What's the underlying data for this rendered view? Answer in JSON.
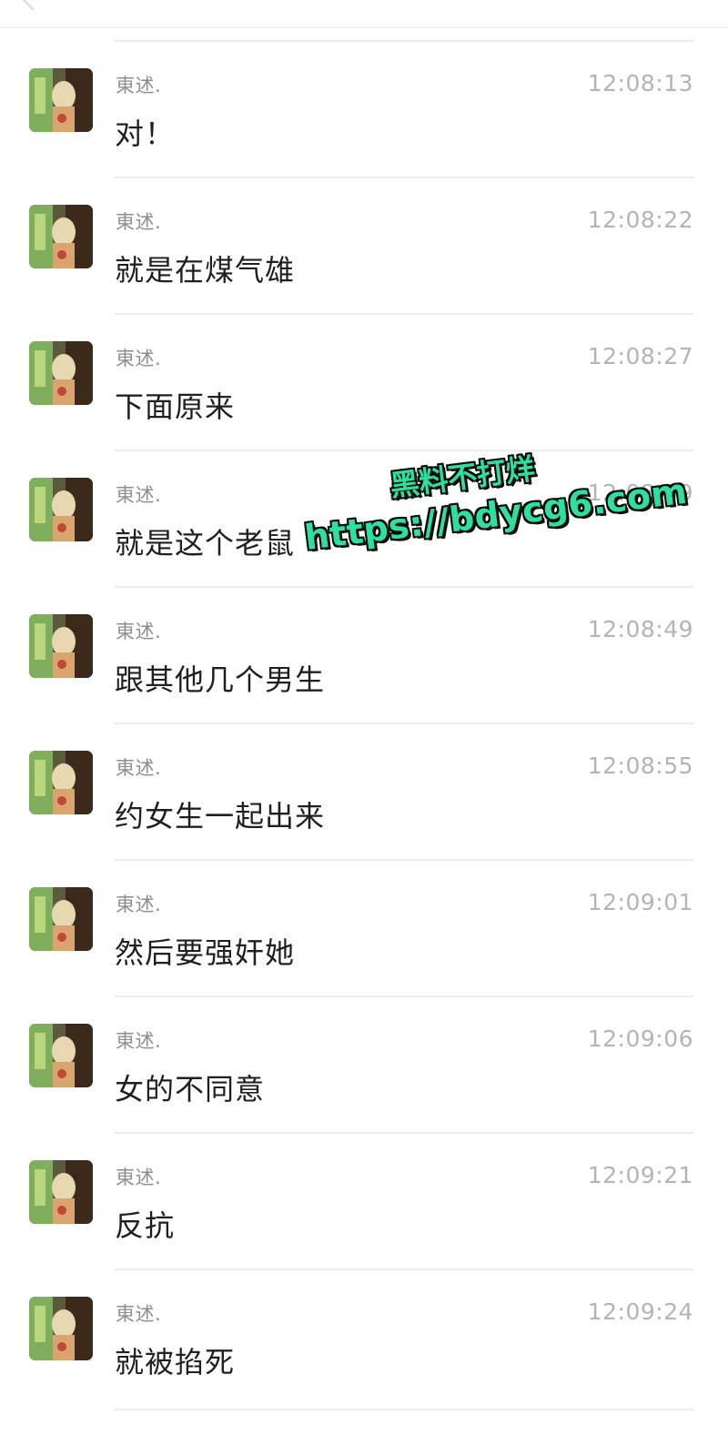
{
  "messages": [
    {
      "sender": "東述.",
      "time": "12:08:13",
      "text": "对！"
    },
    {
      "sender": "東述.",
      "time": "12:08:22",
      "text": "就是在煤气雄"
    },
    {
      "sender": "東述.",
      "time": "12:08:27",
      "text": "下面原来"
    },
    {
      "sender": "東述.",
      "time": "12:08:39",
      "text": "就是这个老鼠"
    },
    {
      "sender": "東述.",
      "time": "12:08:49",
      "text": "跟其他几个男生"
    },
    {
      "sender": "東述.",
      "time": "12:08:55",
      "text": "约女生一起出来"
    },
    {
      "sender": "東述.",
      "time": "12:09:01",
      "text": "然后要强奸她"
    },
    {
      "sender": "東述.",
      "time": "12:09:06",
      "text": "女的不同意"
    },
    {
      "sender": "東述.",
      "time": "12:09:21",
      "text": "反抗"
    },
    {
      "sender": "東述.",
      "time": "12:09:24",
      "text": "就被掐死"
    }
  ],
  "watermark": {
    "line1": "黑料不打烊",
    "line2": "https://bdycg6.com",
    "color": "#2de0a2"
  },
  "colors": {
    "sender": "#8e8e8e",
    "time": "#b4b4b4",
    "text": "#1f1f1f",
    "divider": "#ececec"
  }
}
